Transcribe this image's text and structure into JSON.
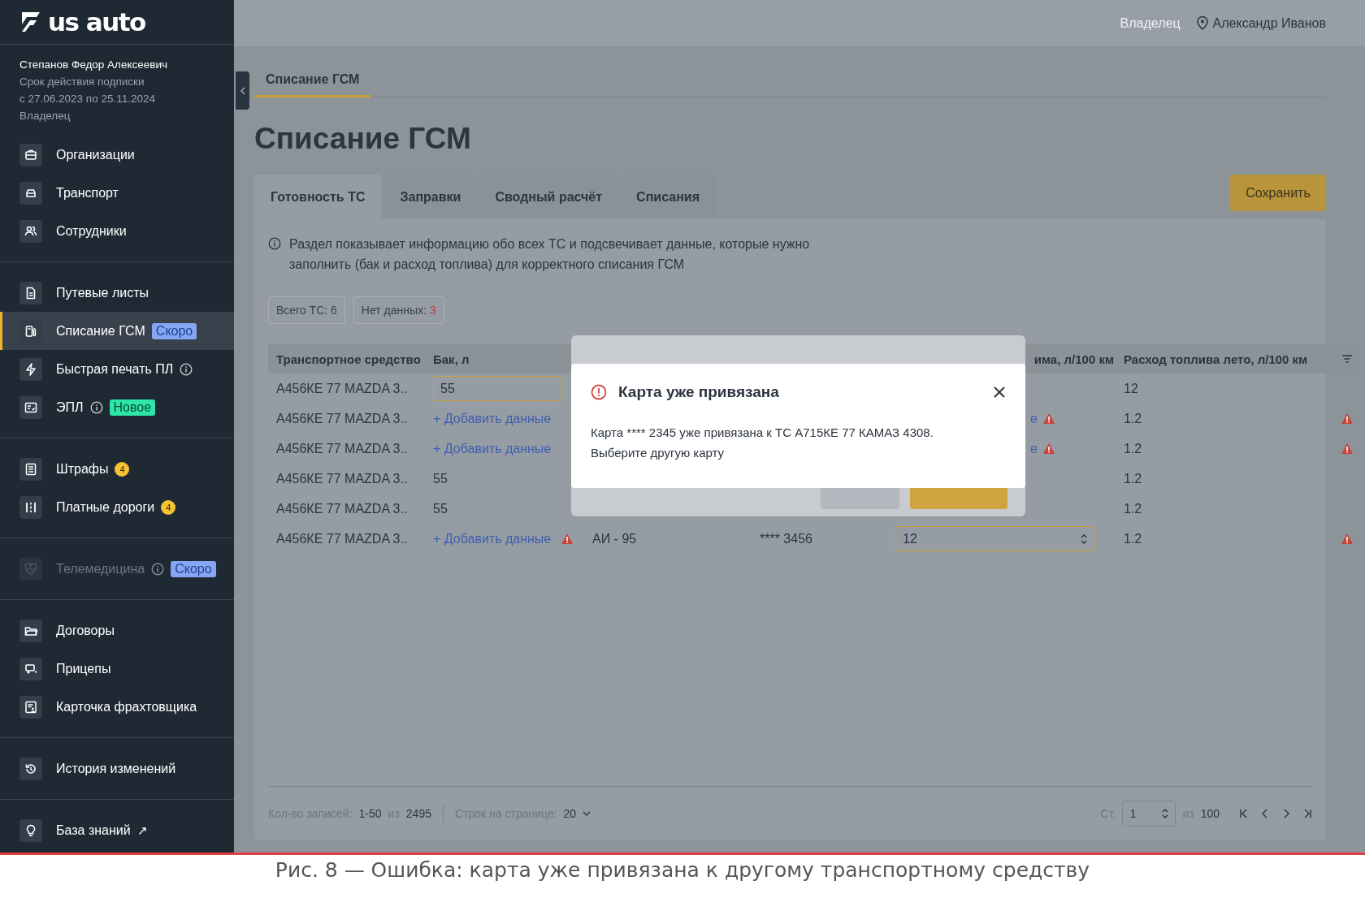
{
  "logo": {
    "text": "us auto"
  },
  "account": {
    "name": "Степанов Федор Алексеевич",
    "subscription_label": "Срок действия подписки",
    "subscription_period": "с 27.06.2023 по 25.11.2024",
    "role": "Владелец"
  },
  "sidebar": {
    "sections": [
      {
        "items": [
          {
            "label": "Организации",
            "selected": false,
            "disabled": false
          },
          {
            "label": "Транспорт",
            "selected": false,
            "disabled": false
          },
          {
            "label": "Сотрудники",
            "selected": false,
            "disabled": false
          }
        ]
      },
      {
        "items": [
          {
            "label": "Путевые листы",
            "selected": false,
            "disabled": false
          },
          {
            "label": "Списание ГСМ",
            "selected": true,
            "disabled": false,
            "badge": {
              "kind": "soon",
              "text": "Скоро"
            }
          },
          {
            "label": "Быстрая печать ПЛ",
            "selected": false,
            "disabled": false,
            "info": true
          },
          {
            "label": "ЭПЛ",
            "selected": false,
            "disabled": false,
            "info": true,
            "badge": {
              "kind": "new",
              "text": "Новое"
            }
          }
        ]
      },
      {
        "items": [
          {
            "label": "Штрафы",
            "selected": false,
            "disabled": false,
            "badge": {
              "kind": "count",
              "text": "4"
            }
          },
          {
            "label": "Платные дороги",
            "selected": false,
            "disabled": false,
            "badge": {
              "kind": "count",
              "text": "4"
            }
          }
        ]
      },
      {
        "items": [
          {
            "label": "Телемедицина",
            "selected": false,
            "disabled": true,
            "info": true,
            "badge": {
              "kind": "soon",
              "text": "Скоро"
            }
          }
        ]
      },
      {
        "items": [
          {
            "label": "Договоры",
            "selected": false,
            "disabled": false
          },
          {
            "label": "Прицепы",
            "selected": false,
            "disabled": false
          },
          {
            "label": "Карточка фрахтовщика",
            "selected": false,
            "disabled": false
          }
        ]
      },
      {
        "items": [
          {
            "label": "История изменений",
            "selected": false,
            "disabled": false
          }
        ]
      },
      {
        "items": [
          {
            "label": "База знаний",
            "selected": false,
            "disabled": false,
            "external": "↗"
          }
        ]
      }
    ]
  },
  "topbar": {
    "role": "Владелец",
    "user": "Александр Иванов"
  },
  "breadcrumb": {
    "label": "Списание ГСМ",
    "selected": true
  },
  "title": "Списание ГСМ",
  "save_button": "Сохранить",
  "tabs": [
    {
      "label": "Готовность ТС",
      "selected": true
    },
    {
      "label": "Заправки",
      "selected": false
    },
    {
      "label": "Сводный расчёт",
      "selected": false
    },
    {
      "label": "Списания",
      "selected": false
    }
  ],
  "info_text": "Раздел показывает информацию обо всех ТС и подсвечивает данные, которые нужно заполнить (бак и расход топлива) для корректного списания ГСМ",
  "chips": [
    {
      "label": "Всего ТС:",
      "value": "6",
      "alert": false
    },
    {
      "label": "Нет данных:",
      "value": "3",
      "alert": true
    }
  ],
  "table": {
    "columns": [
      "Транспортное средство",
      "Бак, л",
      "има, л/100 км",
      "Расход топлива лето, л/100 км"
    ],
    "rows": [
      {
        "vehicle": "А456КЕ 77 MAZDA 3..",
        "tank": {
          "kind": "input",
          "text": "55",
          "highlighted": true
        },
        "summer": "12",
        "warning": false
      },
      {
        "vehicle": "А456КЕ 77 MAZDA 3..",
        "tank": {
          "kind": "link",
          "text": "+ Добавить данные",
          "warning": false
        },
        "winter": {
          "kind": "link",
          "text": "е",
          "warning": true
        },
        "summer": "1.2",
        "warning": true
      },
      {
        "vehicle": "А456КЕ 77 MAZDA 3..",
        "tank": {
          "kind": "link",
          "text": "+ Добавить данные",
          "warning": false
        },
        "winter": {
          "kind": "link",
          "text": "е",
          "warning": true
        },
        "summer": "1.2",
        "warning": true
      },
      {
        "vehicle": "А456КЕ 77 MAZDA 3..",
        "tank": {
          "kind": "text",
          "text": "55"
        },
        "summer": "1.2",
        "warning": false
      },
      {
        "vehicle": "А456КЕ 77 MAZDA 3..",
        "tank": {
          "kind": "text",
          "text": "55"
        },
        "summer": "1.2",
        "warning": false
      },
      {
        "vehicle": "А456КЕ 77 MAZDA 3..",
        "tank": {
          "kind": "link",
          "text": "+ Добавить данные",
          "warning": true
        },
        "fuel": "АИ - 95",
        "card": "**** 3456",
        "winter": {
          "kind": "input",
          "text": "12",
          "highlighted": true
        },
        "summer": "1.2",
        "warning": true
      }
    ]
  },
  "pagination": {
    "records_label": "Кол-во записей:",
    "records_range": "1-50",
    "records_of": "из",
    "records_total": "2495",
    "per_page_label": "Строк на странице:",
    "per_page": "20",
    "page_label": "Ст.",
    "page": "1",
    "pages_of": "из",
    "pages_total": "100"
  },
  "dialog": {
    "title": "Карта уже привязана",
    "message": "Карта **** 2345 уже привязана к ТС А715КЕ 77 КАМАЗ 4308. Выберите другую карту"
  },
  "caption": "Рис. 8 — Ошибка: карта уже привязана к другому транспортному средству"
}
